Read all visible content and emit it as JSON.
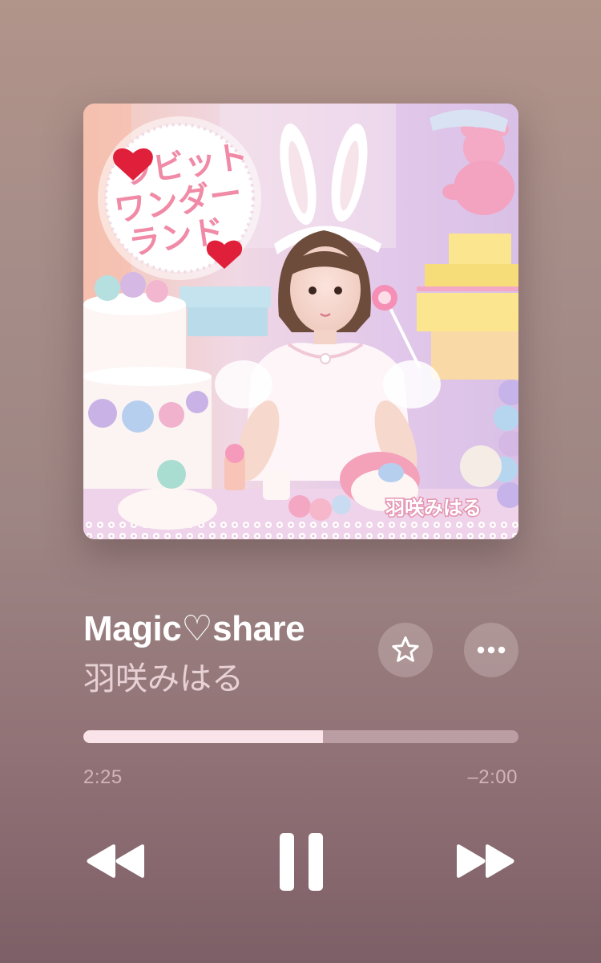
{
  "artwork": {
    "badge_lines": [
      "ラビット",
      "ワンダー",
      "ランド"
    ],
    "artist_overlay": "羽咲みはる"
  },
  "track": {
    "title": "Magic♡share",
    "artist": "羽咲みはる"
  },
  "actions": {
    "favorite_icon": "star-icon",
    "more_icon": "ellipsis-icon"
  },
  "progress": {
    "elapsed": "2:25",
    "remaining": "–2:00",
    "fraction": 0.55
  },
  "controls": {
    "rewind_icon": "rewind-icon",
    "pause_icon": "pause-icon",
    "forward_icon": "fast-forward-icon"
  },
  "colors": {
    "accent": "#fbe4e9",
    "badge_heart": "#e0203a",
    "badge_text": "#f08aa6"
  }
}
